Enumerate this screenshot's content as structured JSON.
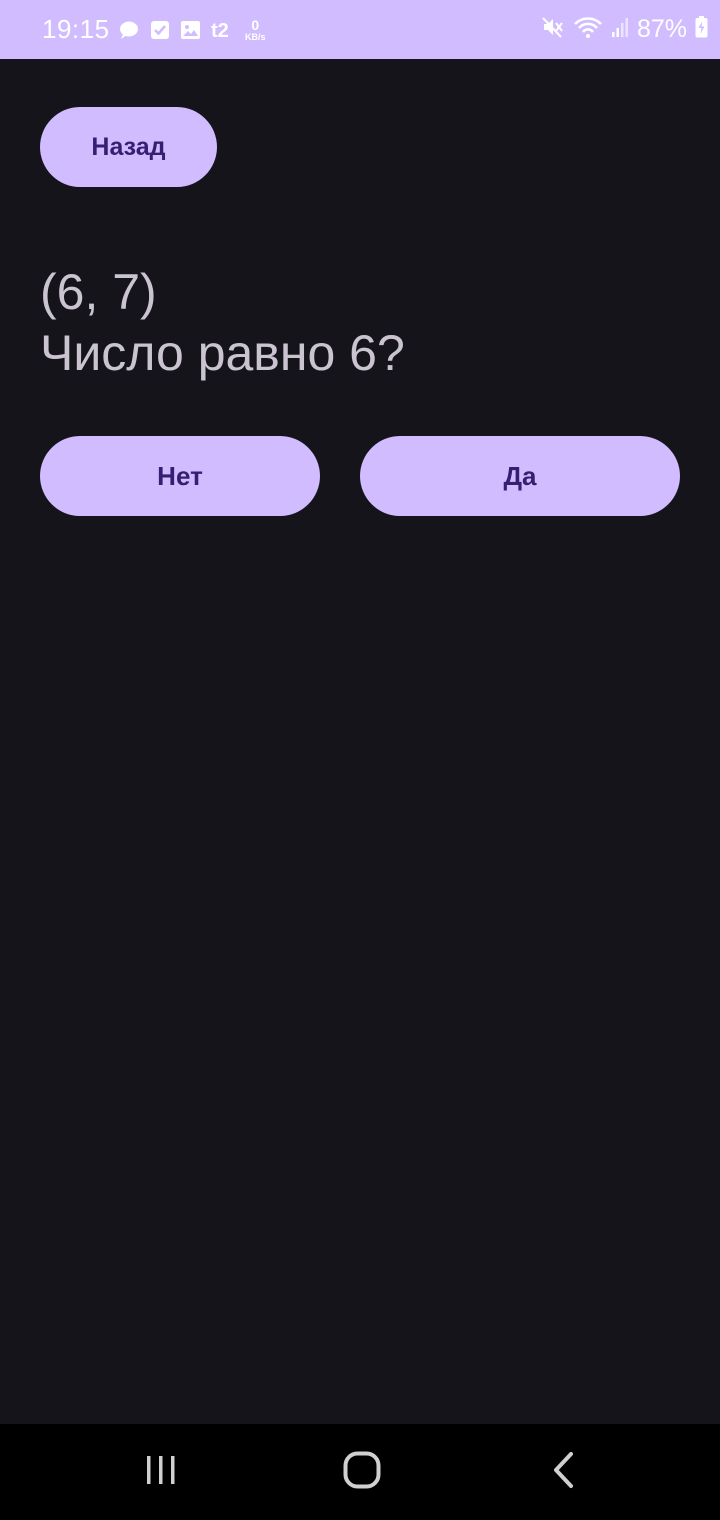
{
  "status_bar": {
    "time": "19:15",
    "net_speed_value": "0",
    "net_speed_unit": "KB/s",
    "carrier_icon_text": "t2",
    "battery_percent": "87%",
    "icons": [
      "messages-icon",
      "checkbox-icon",
      "gallery-icon",
      "carrier-icon",
      "mute-icon",
      "wifi-icon",
      "signal-icon",
      "battery-charging-icon"
    ]
  },
  "header": {
    "back_label": "Назад"
  },
  "question": {
    "range": "(6, 7)",
    "text": "Число равно 6?"
  },
  "answers": {
    "no_label": "Нет",
    "yes_label": "Да"
  },
  "nav_bar": {
    "icons": [
      "recent-apps-icon",
      "home-icon",
      "back-icon"
    ]
  },
  "colors": {
    "accent": "#d0bcff",
    "on_accent": "#381e72",
    "background": "#16141b",
    "text_secondary": "#cac4d0",
    "nav_background": "#000000"
  }
}
